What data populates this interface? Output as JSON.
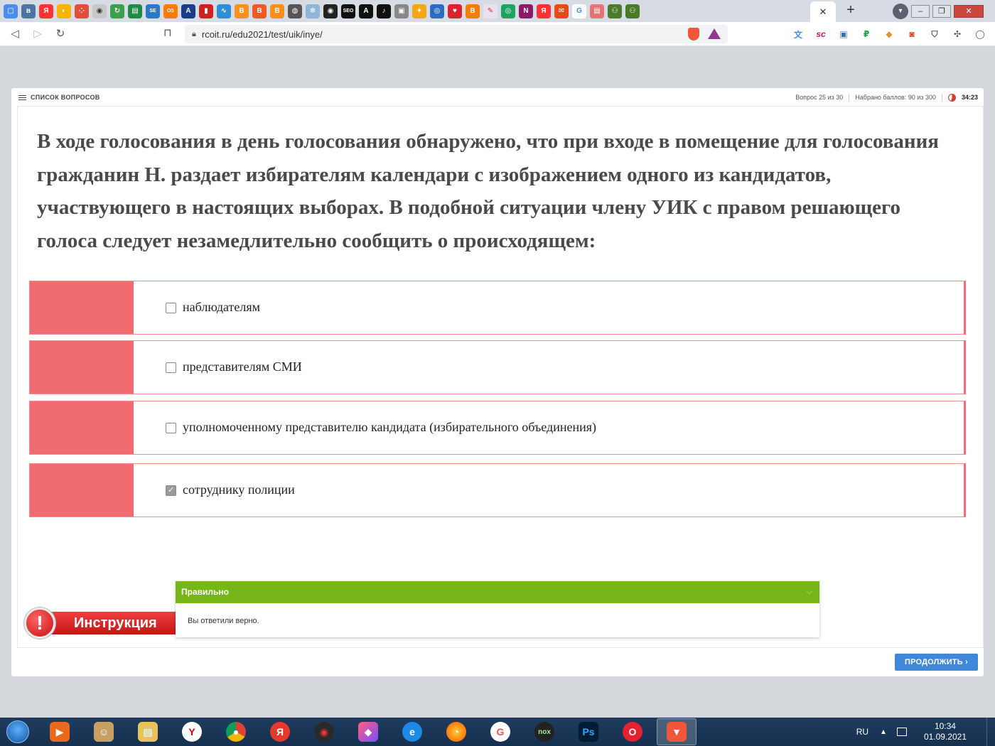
{
  "browser": {
    "tab_close": "✕",
    "new_tab": "+",
    "url": "rcoit.ru/edu2021/test/uik/inye/",
    "bookmark_icons": [
      "chat-icon",
      "vk-icon",
      "yandex-icon",
      "chart-icon",
      "google-apps-icon",
      "eye-icon",
      "sync-icon",
      "excel-icon",
      "serp-icon",
      "onlysure-icon",
      "aw-icon",
      "bar-chart-icon",
      "link-icon",
      "blogger-icon",
      "blogger-icon",
      "blogger-icon",
      "globe-icon",
      "gear-icon",
      "eye-icon",
      "seo-icon",
      "letter-a-icon",
      "tiktok-icon",
      "box-icon",
      "star-icon",
      "owl-icon",
      "heart-icon",
      "blogger-icon",
      "pen-icon",
      "circle-icon",
      "n-icon",
      "yandex-icon",
      "mail-icon",
      "google-icon",
      "doc-icon",
      "people-icon",
      "people-icon"
    ],
    "extension_icons": [
      "translate-icon",
      "sc-icon",
      "lock-icon",
      "ruble-icon",
      "cube-icon",
      "rss-icon",
      "shield-icon",
      "puzzle-icon",
      "profile-icon"
    ]
  },
  "header": {
    "question_list_label": "СПИСОК ВОПРОСОВ",
    "progress": "Вопрос 25 из 30",
    "score": "Набрано баллов: 90 из 300",
    "timer": "34:23"
  },
  "question": {
    "text": "В ходе голосования в день голосования обнаружено, что при входе в помещение для голосования гражданин Н. раздает избирателям календари с изображением одного из кандидатов, участвующего в настоящих выборах. В подобной ситуации члену УИК с правом решающего голоса следует незамедлительно сообщить о происходящем:"
  },
  "options": [
    {
      "label": "наблюдателям",
      "checked": false
    },
    {
      "label": "представителям СМИ",
      "checked": false
    },
    {
      "label": "уполномоченному представителю кандидата (избирательного объединения)",
      "checked": false
    },
    {
      "label": "сотруднику полиции",
      "checked": true
    }
  ],
  "instruction": {
    "label": "Инструкция",
    "icon": "!"
  },
  "feedback": {
    "title": "Правильно",
    "message": "Вы ответили верно.",
    "color": "#77b618"
  },
  "continue_label": "ПРОДОЛЖИТЬ",
  "colors": {
    "option_marker": "#f06c70",
    "accent_blue": "#3f88d9"
  },
  "taskbar": {
    "apps": [
      "media-player",
      "user-account",
      "file-explorer",
      "yandex-browser",
      "chrome",
      "yandex",
      "opera-gx",
      "crystal-app",
      "internet-explorer",
      "firefox",
      "avast-browser",
      "nox-player",
      "photoshop",
      "opera",
      "brave"
    ],
    "language": "RU",
    "time": "10:34",
    "date": "01.09.2021"
  }
}
